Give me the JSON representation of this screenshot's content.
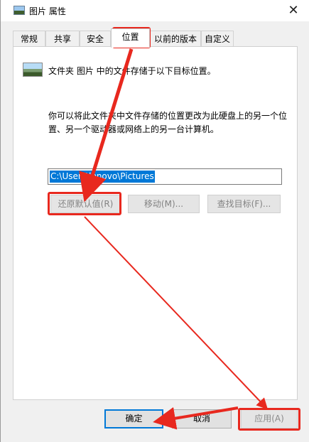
{
  "window": {
    "title": "图片 属性",
    "close_glyph": "✕"
  },
  "tabs": [
    {
      "label": "常规"
    },
    {
      "label": "共享"
    },
    {
      "label": "安全"
    },
    {
      "label": "位置",
      "active": true
    },
    {
      "label": "以前的版本"
    },
    {
      "label": "自定义"
    }
  ],
  "location_tab": {
    "folder_text": "文件夹 图片 中的文件存储于以下目标位置。",
    "description": "你可以将此文件夹中文件存储的位置更改为此硬盘上的另一个位置、另一个驱动器或网络上的另一台计算机。",
    "path_value": "C:\\Users\\lenovo\\Pictures",
    "restore_default_label": "还原默认值(R)",
    "move_label": "移动(M)...",
    "find_target_label": "查找目标(F)..."
  },
  "footer": {
    "ok_label": "确定",
    "cancel_label": "取消",
    "apply_label": "应用(A)"
  },
  "colors": {
    "annotation_red": "#e8281e",
    "selection_blue": "#0078d7"
  },
  "icons": {
    "window": "picture-folder-icon",
    "folder": "picture-folder-icon",
    "close": "close-icon"
  }
}
